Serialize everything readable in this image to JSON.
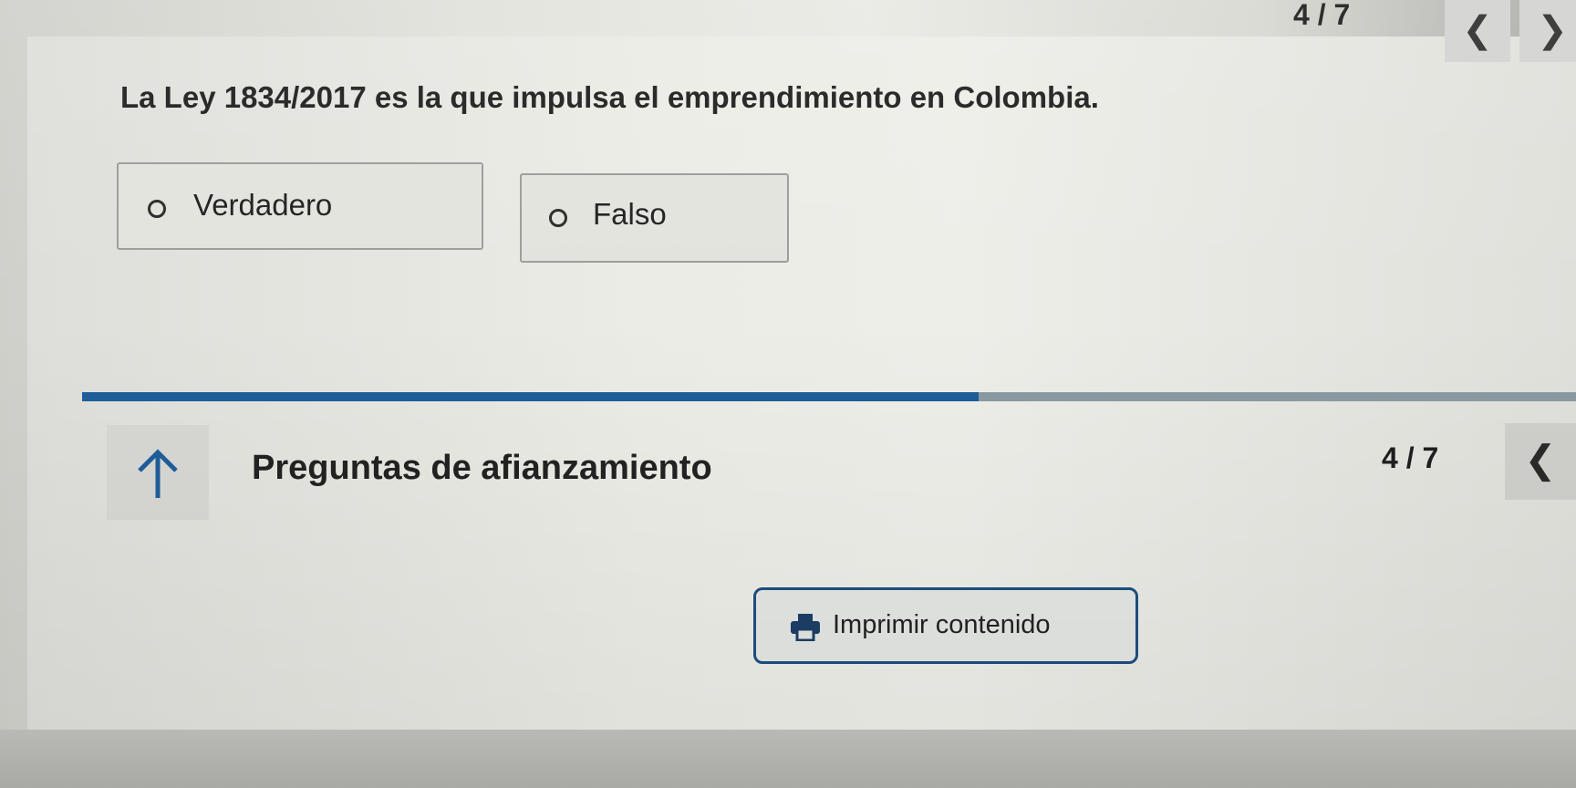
{
  "header": {
    "counter": "4 / 7",
    "prev_icon": "chevron-left-icon",
    "next_icon": "chevron-right-icon",
    "prev_glyph": "❮",
    "next_glyph": "❯"
  },
  "question": {
    "text": "La Ley 1834/2017 es la que impulsa el emprendimiento en Colombia.",
    "options": [
      {
        "label": "Verdadero",
        "selected": false
      },
      {
        "label": "Falso",
        "selected": false
      }
    ]
  },
  "progress": {
    "value": 0.6,
    "fill_color": "#1f5e9a"
  },
  "footer": {
    "up_icon": "arrow-up-icon",
    "section_title": "Preguntas de afianzamiento",
    "counter": "4 / 7",
    "prev_glyph": "❮"
  },
  "print": {
    "label": "Imprimir contenido",
    "icon": "printer-icon",
    "border_color": "#1d4f80"
  }
}
